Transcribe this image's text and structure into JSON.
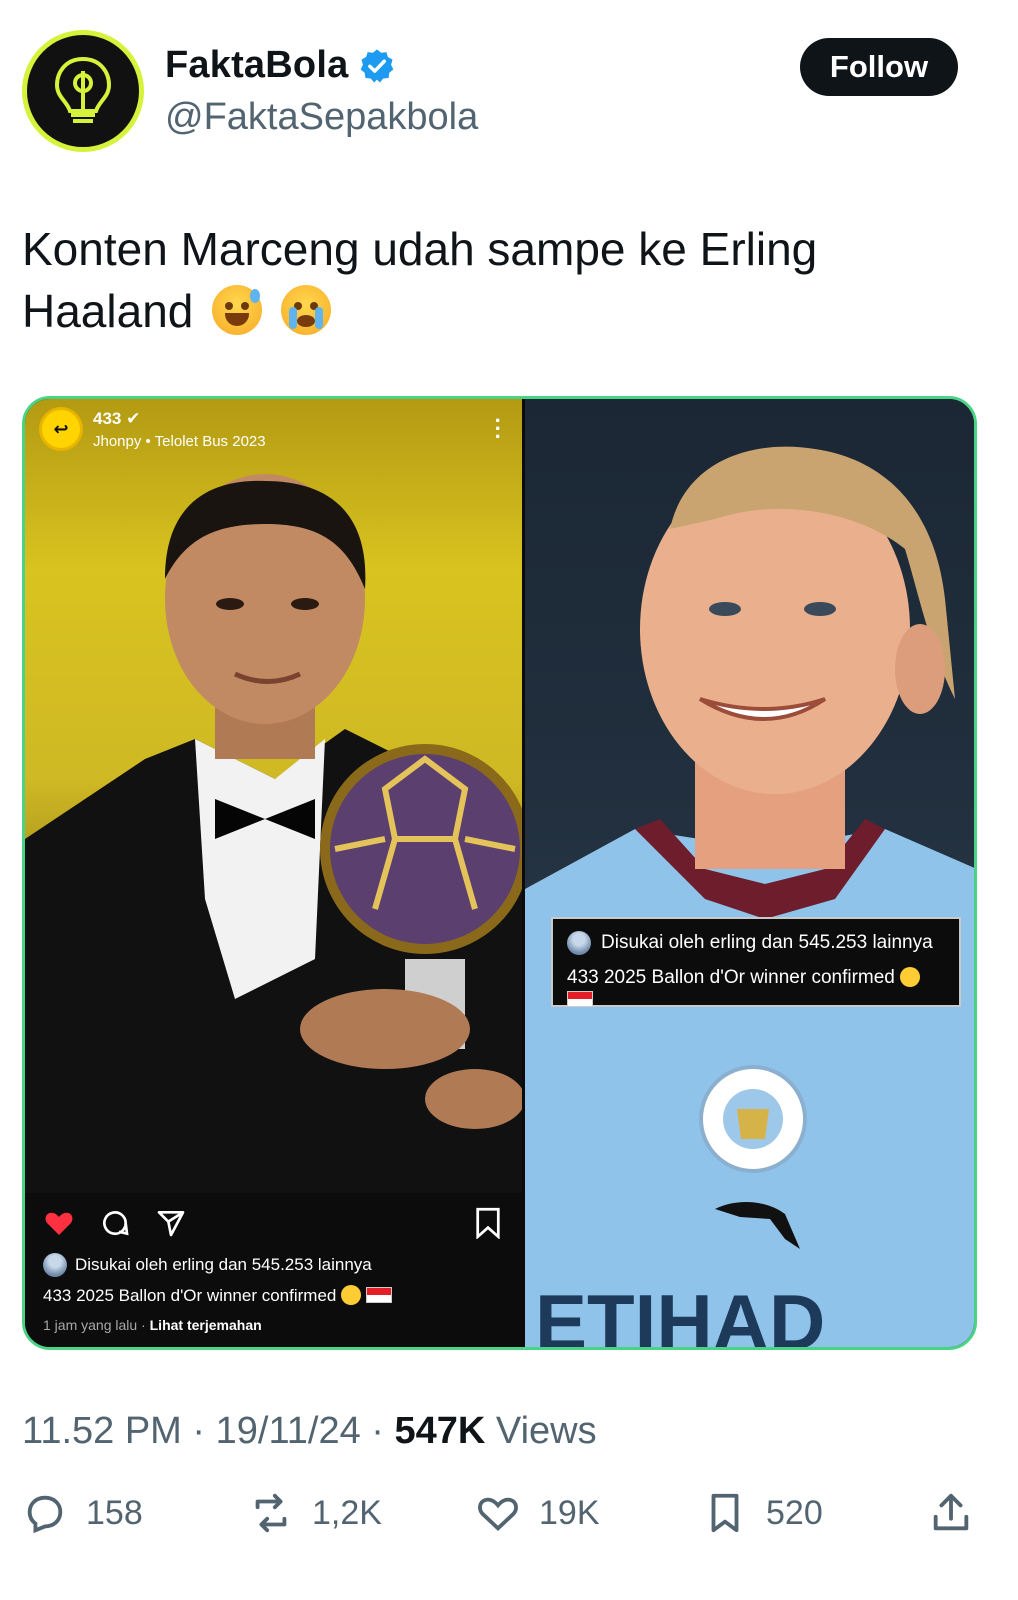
{
  "author": {
    "display_name": "FaktaBola",
    "handle": "@FaktaSepakbola",
    "verified": true
  },
  "follow_label": "Follow",
  "tweet": {
    "text": "Konten Marceng udah sampe ke Erling Haaland",
    "emojis": [
      "grinning-sweat-emoji",
      "loudly-crying-emoji"
    ]
  },
  "media": {
    "left": {
      "account": "433",
      "subtitle": "Jhonpy • Telolet Bus 2023",
      "liked_by": "Disukai oleh erling dan 545.253 lainnya",
      "caption": "433 2025 Ballon d'Or winner confirmed",
      "time": "1 jam yang lalu",
      "translate": "Lihat terjemahan"
    },
    "right": {
      "liked_by": "Disukai oleh erling dan 545.253 lainnya",
      "caption": "433 2025 Ballon d'Or winner confirmed",
      "shirt_sponsor": "ETIHAD"
    }
  },
  "meta": {
    "time": "11.52 PM",
    "date": "19/11/24",
    "views_count": "547K",
    "views_label": "Views"
  },
  "stats": {
    "replies": "158",
    "reposts": "1,2K",
    "likes": "19K",
    "bookmarks": "520"
  },
  "colors": {
    "accent": "#1d9bf0",
    "text": "#0f1419",
    "muted": "#536471",
    "media_border": "#4bd385"
  }
}
